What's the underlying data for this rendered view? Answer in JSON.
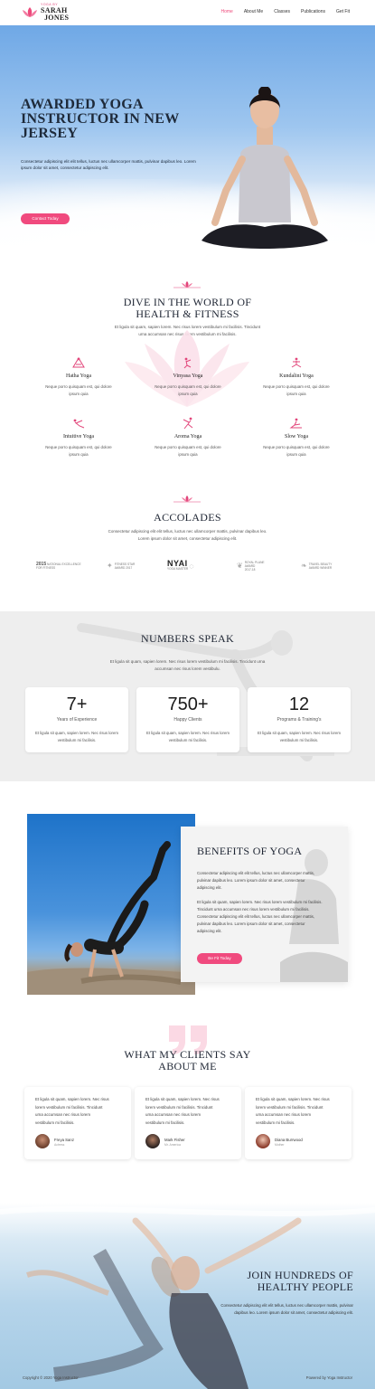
{
  "brand": {
    "tagline": "YOGA BY",
    "name_line1": "SARAH",
    "name_line2": "JONES",
    "accent_color": "#f04a7e"
  },
  "nav": {
    "items": [
      "Home",
      "About Me",
      "Classes",
      "Publications",
      "Get Fit"
    ],
    "active": "Home"
  },
  "hero": {
    "title": "AWARDED YOGA INSTRUCTOR IN NEW JERSEY",
    "text": "Consectetur adipiscing elit elit tellus, luctus nec ullamcorper mattis, pulvinar dapibus leo. Lorem ipsum dolor sit amet, consectetur adipiscing elit.",
    "button": "Contact Today"
  },
  "dive": {
    "title_line1": "DIVE IN THE WORLD OF",
    "title_line2": "HEALTH & FITNESS",
    "text_line1": "Et ligula sit quam, sapien lorem. Nec risus lorem vestibulum mi facilisis. Tincidunt",
    "text_line2": "urna accumsan nec risus lorem vestibulum mi facilisis.",
    "features": [
      {
        "icon": "hatha-yoga-icon",
        "title": "Hatha Yoga",
        "text_line1": "Neque porro quisquam est, qui dolore",
        "text_line2": "ipsum quia"
      },
      {
        "icon": "vinyasa-yoga-icon",
        "title": "Vinyasa Yoga",
        "text_line1": "Neque porro quisquam est, qui dolore",
        "text_line2": "ipsum quia"
      },
      {
        "icon": "kundalini-yoga-icon",
        "title": "Kundalini Yoga",
        "text_line1": "Neque porro quisquam est, qui dolore",
        "text_line2": "ipsum quia"
      },
      {
        "icon": "intuitive-yoga-icon",
        "title": "Intuitive Yoga",
        "text_line1": "Neque porro quisquam est, qui dolore",
        "text_line2": "ipsum quia"
      },
      {
        "icon": "aroma-yoga-icon",
        "title": "Aroma Yoga",
        "text_line1": "Neque porro quisquam est, qui dolore",
        "text_line2": "ipsum quia"
      },
      {
        "icon": "slow-yoga-icon",
        "title": "Slow Yoga",
        "text_line1": "Neque porro quisquam est, qui dolore",
        "text_line2": "ipsum quia"
      }
    ]
  },
  "accolades": {
    "title": "ACCOLADES",
    "text_line1": "Consectetur adipiscing elit elit tellus, luctus nec ullamcorper mattis, pulvinar dapibus leo.",
    "text_line2": "Lorem ipsum dolor sit amet, consectetur adipiscing elit.",
    "awards": [
      {
        "line1": "2015",
        "line2": "NATIONAL EXCELLENCE",
        "line3": "FOR FITNESS"
      },
      {
        "line1": "FITNESS STAR",
        "line2": "AWARD 2017",
        "line3": ""
      },
      {
        "line1": "NYAI",
        "line2": "YOGA MASTER",
        "line3": ""
      },
      {
        "line1": "ROYAL PLANE",
        "line2": "AWARD",
        "line3": "2017-18"
      },
      {
        "line1": "TRAVEL BEAUTY",
        "line2": "AWARD WINNER",
        "line3": ""
      }
    ]
  },
  "numbers": {
    "title": "NUMBERS SPEAK",
    "text_line1": "Et ligula sit quam, sapien lorem. Nec risus lorem vestibulum mi facilisis. Tincidunt urna",
    "text_line2": "accumsan nec risus lorem vestibulu.",
    "stats": [
      {
        "value": "7+",
        "label": "Years of Experience",
        "text_line1": "Et ligula sit quam, sapien lorem. Nec risus lorem",
        "text_line2": "vestibulum mi facilisis."
      },
      {
        "value": "750+",
        "label": "Happy Clients",
        "text_line1": "Et ligula sit quam, sapien lorem. Nec risus lorem",
        "text_line2": "vestibulum mi facilisis."
      },
      {
        "value": "12",
        "label": "Programs & Training's",
        "text_line1": "Et ligula sit quam, sapien lorem. Nec risus lorem",
        "text_line2": "vestibulum mi facilisis."
      }
    ]
  },
  "benefits": {
    "title": "BENEFITS OF YOGA",
    "p1": [
      "Consectetur adipiscing elit elit tellus, luctus nec ullamcorper mattis,",
      "pulvinar dapibus leo. Lorem ipsum dolor sit amet, consectetur",
      "adipiscing elit."
    ],
    "p2": [
      "Et ligula sit quam, sapien lorem. Nec risus lorem vestibulum mi facilisis.",
      "Tincidunt urna accumsan nec risus lorem vestibulum mi facilisis.",
      "Consectetur adipiscing elit elit tellus, luctus nec ullamcorper mattis,",
      "pulvinar dapibus leo. Lorem ipsum dolor sit amet, consectetur",
      "adipiscing elit."
    ],
    "button": "Be Fit Today"
  },
  "testimonials": {
    "title_line1": "WHAT MY CLIENTS SAY",
    "title_line2": "ABOUT ME",
    "items": [
      {
        "text": [
          "Et ligula sit quam, sapien lorem. Nec risus",
          "lorem vestibulum mi facilisis. Tincidunt",
          "urna accumsan nec risus lorem",
          "vestibulum mi facilisis."
        ],
        "name": "Freya Sanz",
        "role": "Actress"
      },
      {
        "text": [
          "Et ligula sit quam, sapien lorem. Nec risus",
          "lorem vestibulum mi facilisis. Tincidunt",
          "urna accumsan nec risus lorem",
          "vestibulum mi facilisis."
        ],
        "name": "Mark Fisher",
        "role": "Mr. America"
      },
      {
        "text": [
          "Et ligula sit quam, sapien lorem. Nec risus",
          "lorem vestibulum mi facilisis. Tincidunt",
          "urna accumsan nec risus lorem",
          "vestibulum mi facilisis."
        ],
        "name": "Diana Burrwood",
        "role": "Mother"
      }
    ]
  },
  "join": {
    "title_line1": "JOIN HUNDREDS OF",
    "title_line2": "HEALTHY PEOPLE",
    "text_line1": "Consectetur adipiscing elit elit tellus, luctus nec ullamcorper mattis, pulvinar",
    "text_line2": "dapibus leo. Lorem ipsum dolor sit amet, consectetur adipiscing elit."
  },
  "footer": {
    "copyright": "Copyright © 2020 Yoga Instructor",
    "powered": "Powered by Yoga Instructor"
  }
}
